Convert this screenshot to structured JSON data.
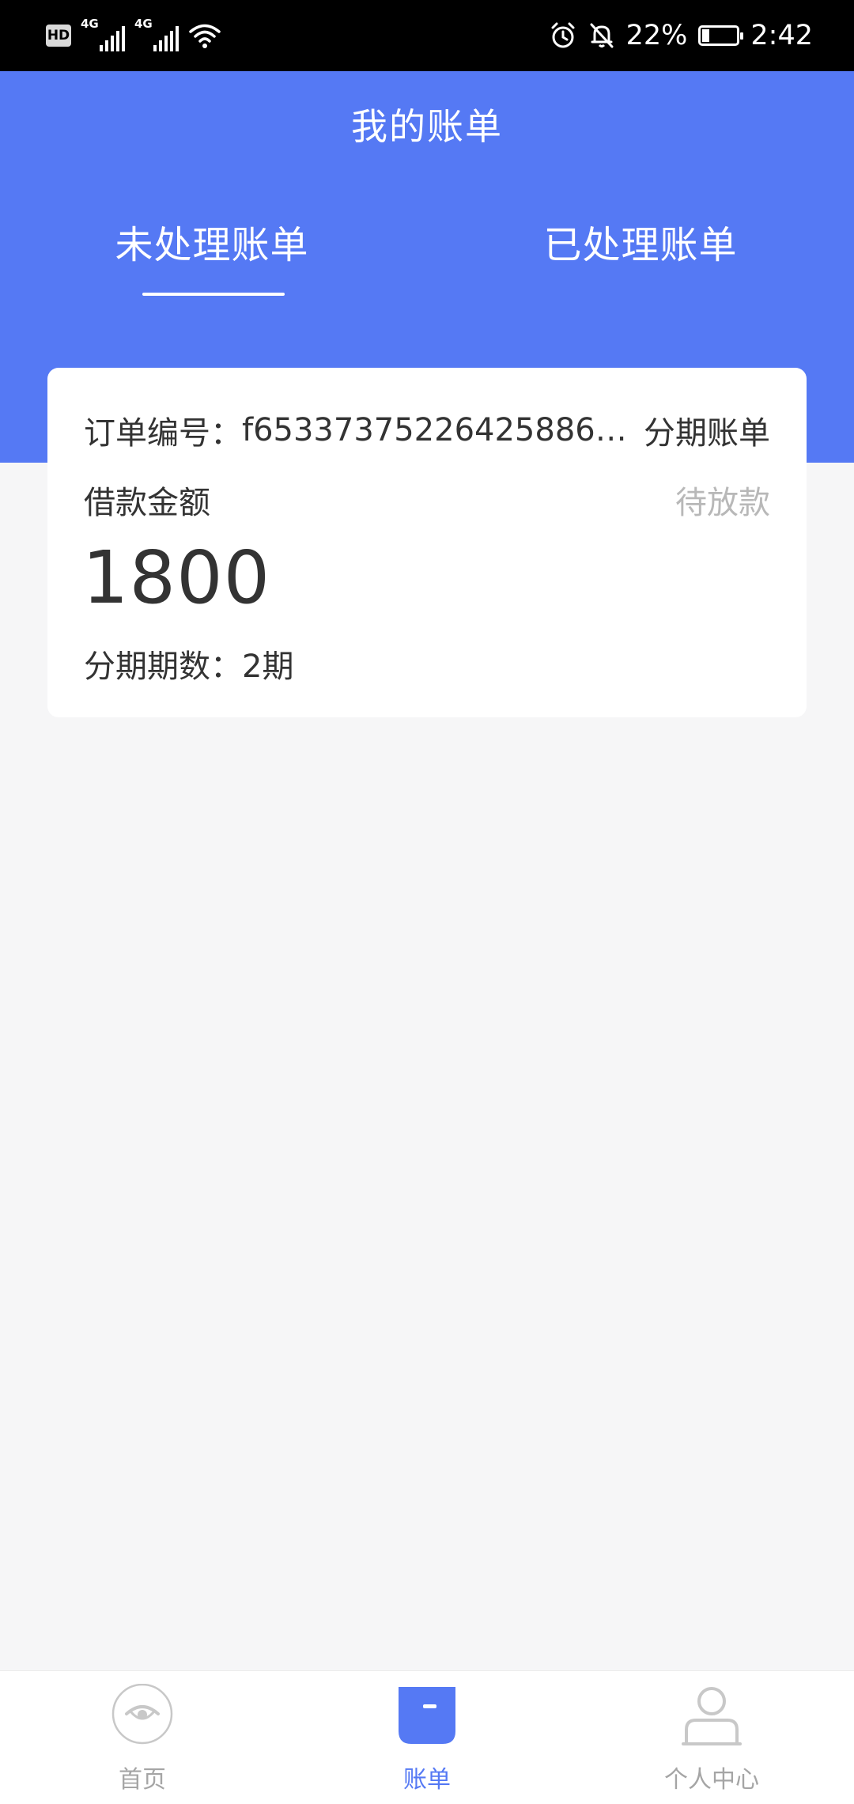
{
  "status_bar": {
    "hd": "HD",
    "signal1": "4G",
    "signal2": "4G",
    "battery_percent": "22%",
    "time": "2:42",
    "battery_level": 0.22,
    "icons": [
      "hd-icon",
      "signal-icon",
      "wifi-icon",
      "alarm-icon",
      "mute-icon",
      "battery-icon"
    ]
  },
  "header": {
    "title": "我的账单",
    "tabs": [
      {
        "label": "未处理账单",
        "active": true
      },
      {
        "label": "已处理账单",
        "active": false
      }
    ]
  },
  "bill_card": {
    "order_label": "订单编号：",
    "order_no": "f65337375226425886b…",
    "bill_type": "分期账单",
    "amount_label": "借款金额",
    "status": "待放款",
    "amount": "1800",
    "periods_label": "分期期数：",
    "periods_value": "2期"
  },
  "bottom_nav": {
    "items": [
      {
        "label": "首页",
        "icon": "home-eye-icon",
        "active": false
      },
      {
        "label": "账单",
        "icon": "bill-icon",
        "active": true
      },
      {
        "label": "个人中心",
        "icon": "user-icon",
        "active": false
      }
    ]
  },
  "colors": {
    "primary": "#5579f4",
    "background": "#f6f6f7",
    "muted": "#b8b8b8",
    "nav_inactive": "#a5a5a5"
  }
}
